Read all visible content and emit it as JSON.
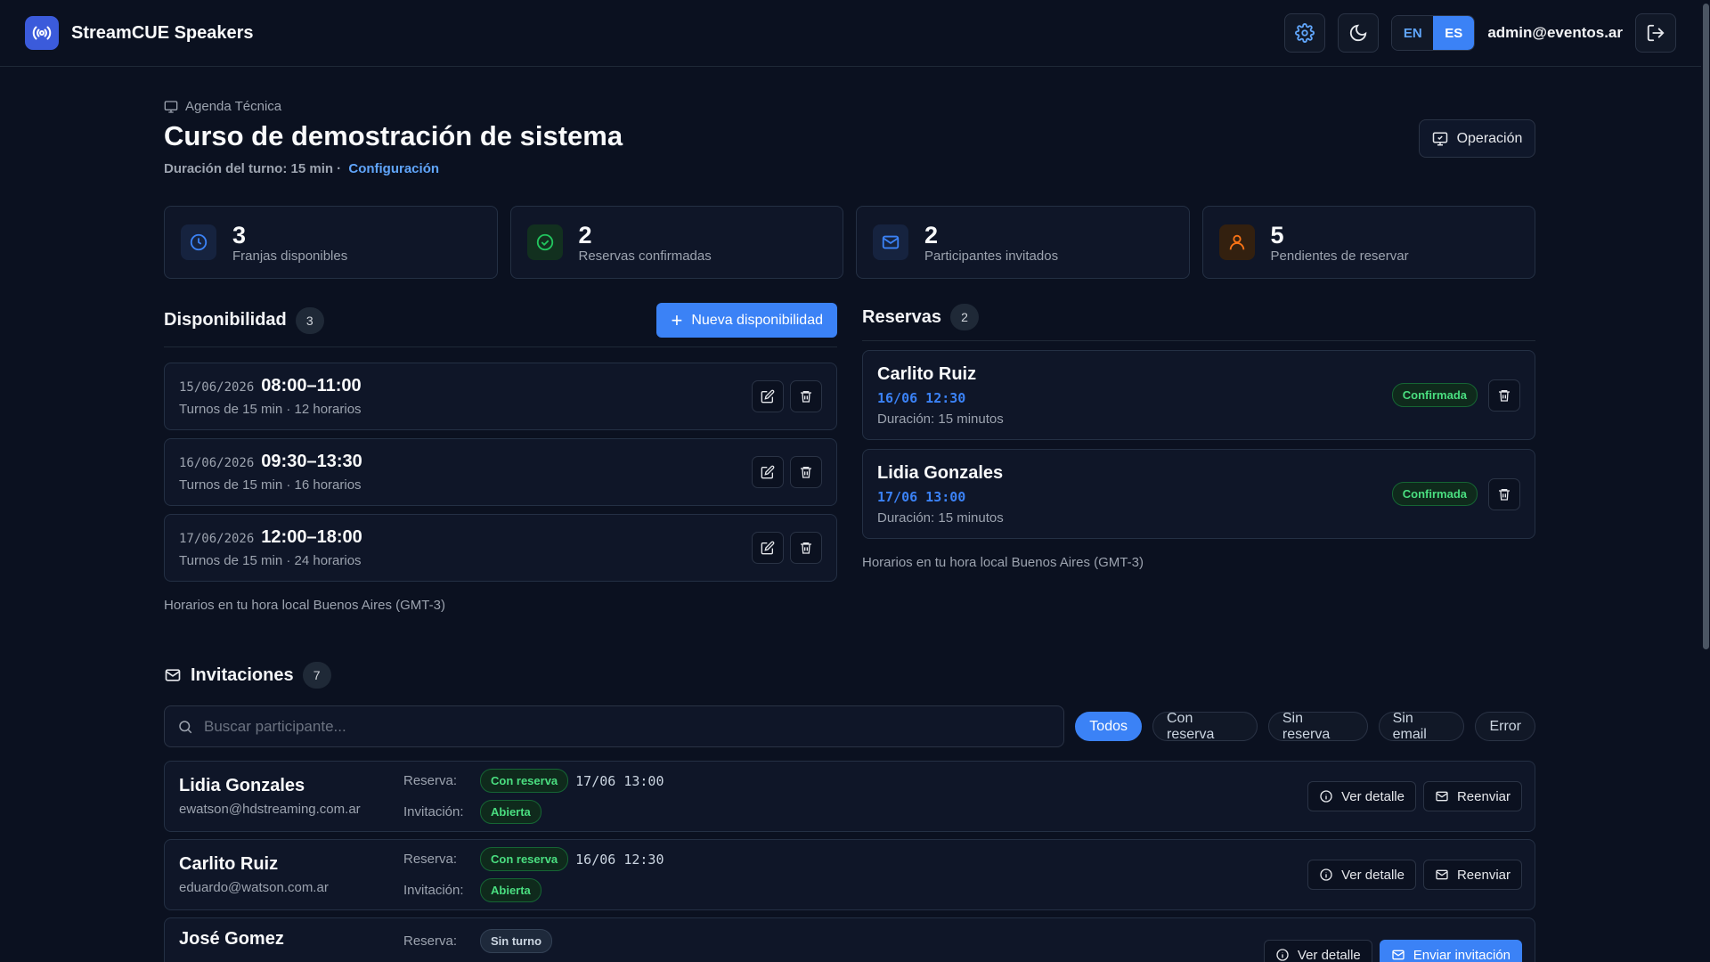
{
  "app": {
    "name": "StreamCUE Speakers",
    "user_email": "admin@eventos.ar",
    "lang_en": "EN",
    "lang_es": "ES"
  },
  "page": {
    "breadcrumb": "Agenda Técnica",
    "title": "Curso de demostración de sistema",
    "duration_text": "Duración del turno: 15 min ·",
    "config_link": "Configuración",
    "operation_button": "Operación"
  },
  "stats": [
    {
      "value": "3",
      "label": "Franjas disponibles",
      "icon": "clock-icon",
      "color": "#3b82f6"
    },
    {
      "value": "2",
      "label": "Reservas confirmadas",
      "icon": "check-circle-icon",
      "color": "#22c55e"
    },
    {
      "value": "2",
      "label": "Participantes invitados",
      "icon": "mail-icon",
      "color": "#3b82f6"
    },
    {
      "value": "5",
      "label": "Pendientes de reservar",
      "icon": "user-icon",
      "color": "#f97316"
    }
  ],
  "availability": {
    "title": "Disponibilidad",
    "count": "3",
    "new_button": "Nueva disponibilidad",
    "slots": [
      {
        "date": "15/06/2026",
        "time": "08:00–11:00",
        "meta": "Turnos de 15 min · 12 horarios"
      },
      {
        "date": "16/06/2026",
        "time": "09:30–13:30",
        "meta": "Turnos de 15 min · 16 horarios"
      },
      {
        "date": "17/06/2026",
        "time": "12:00–18:00",
        "meta": "Turnos de 15 min · 24 horarios"
      }
    ],
    "tz_note": "Horarios en tu hora local Buenos Aires (GMT-3)"
  },
  "reservations": {
    "title": "Reservas",
    "count": "2",
    "items": [
      {
        "name": "Carlito Ruiz",
        "when": "16/06 12:30",
        "duration": "Duración: 15 minutos",
        "status": "Confirmada"
      },
      {
        "name": "Lidia Gonzales",
        "when": "17/06 13:00",
        "duration": "Duración: 15 minutos",
        "status": "Confirmada"
      }
    ],
    "tz_note": "Horarios en tu hora local Buenos Aires (GMT-3)"
  },
  "invitations": {
    "title": "Invitaciones",
    "count": "7",
    "search_placeholder": "Buscar participante...",
    "filters": [
      "Todos",
      "Con reserva",
      "Sin reserva",
      "Sin email",
      "Error"
    ],
    "label_reserva": "Reserva:",
    "label_invitacion": "Invitación:",
    "btn_detail": "Ver detalle",
    "btn_resend": "Reenviar",
    "btn_send": "Enviar invitación",
    "rows": [
      {
        "name": "Lidia Gonzales",
        "email": "ewatson@hdstreaming.com.ar",
        "reserva": "Con reserva",
        "when": "17/06 13:00",
        "invitacion": "Abierta"
      },
      {
        "name": "Carlito Ruiz",
        "email": "eduardo@watson.com.ar",
        "reserva": "Con reserva",
        "when": "16/06 12:30",
        "invitacion": "Abierta"
      },
      {
        "name": "José Gomez",
        "reserva": "Sin turno"
      }
    ]
  }
}
